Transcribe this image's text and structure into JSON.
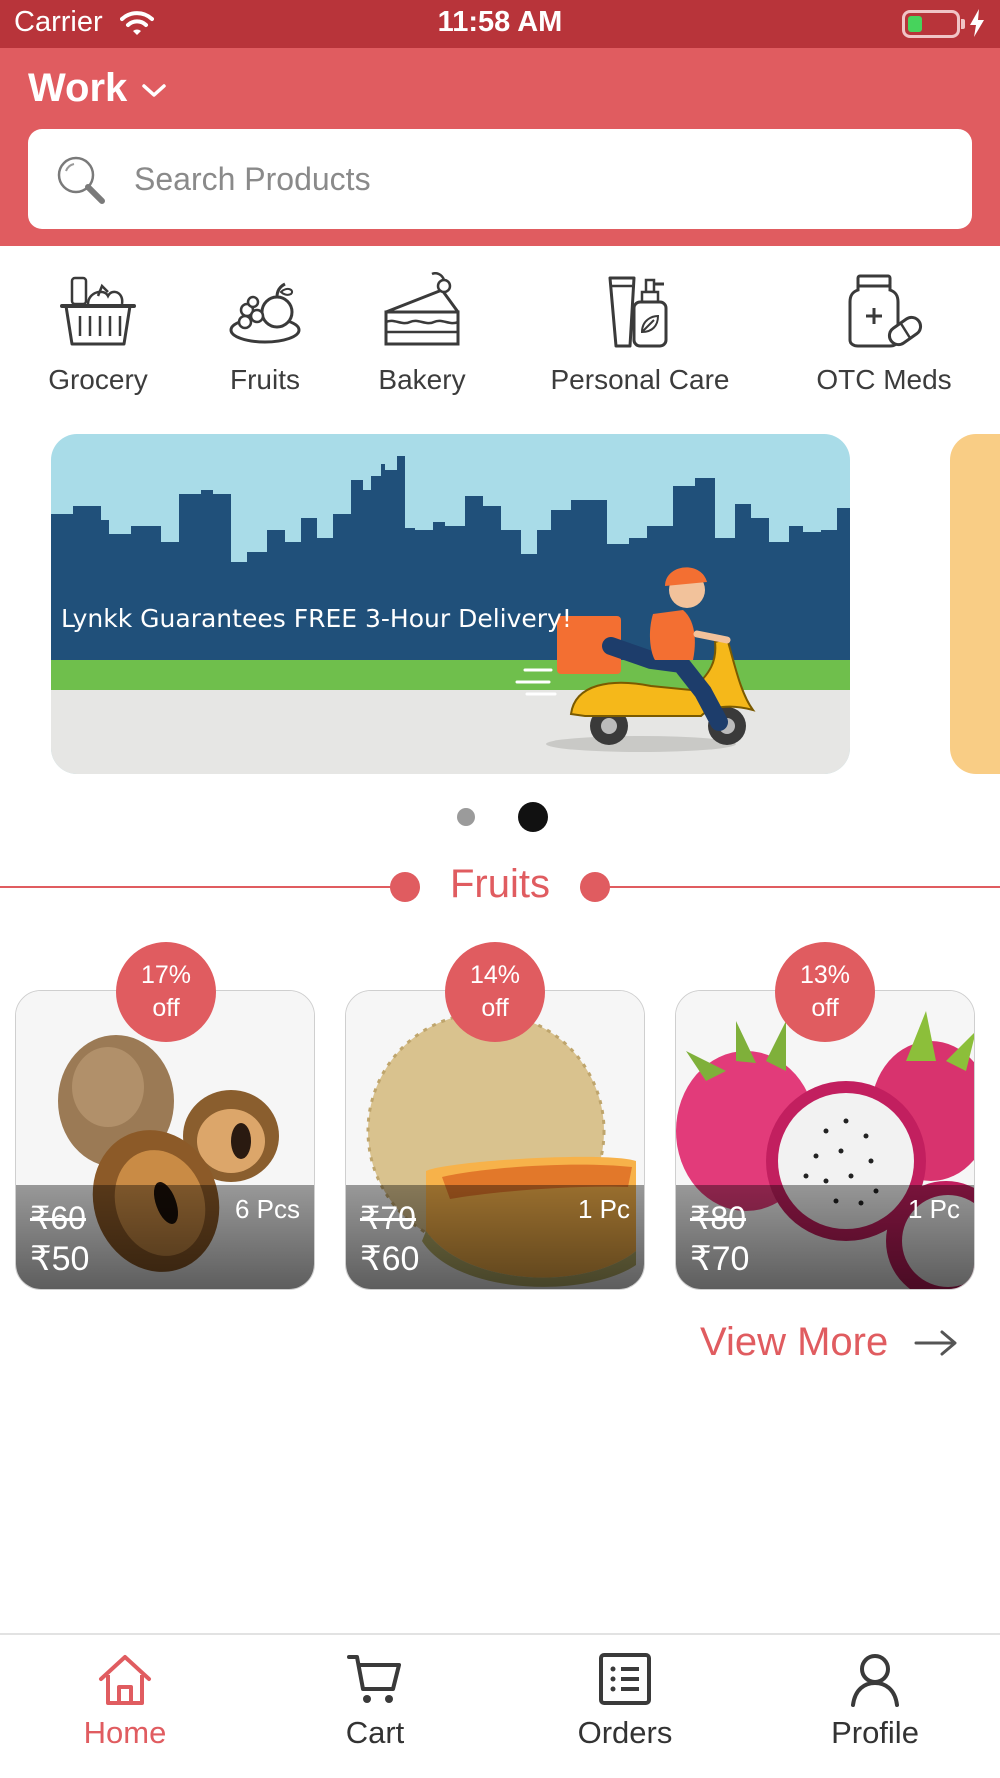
{
  "status_bar": {
    "carrier": "Carrier",
    "time": "11:58 AM",
    "battery_level": 0.3
  },
  "header": {
    "location_label": "Work"
  },
  "search": {
    "placeholder": "Search Products"
  },
  "categories": [
    {
      "label": "Grocery",
      "icon": "grocery-basket-icon"
    },
    {
      "label": "Fruits",
      "icon": "fruits-icon"
    },
    {
      "label": "Bakery",
      "icon": "cake-icon"
    },
    {
      "label": "Personal Care",
      "icon": "lotion-bottle-icon"
    },
    {
      "label": "OTC Meds",
      "icon": "medicine-icon"
    }
  ],
  "banner": {
    "text": "Lynkk Guarantees FREE 3-Hour Delivery!",
    "active_slide": 2,
    "slide_count": 2
  },
  "section": {
    "title": "Fruits"
  },
  "products": [
    {
      "discount_line1": "17%",
      "discount_line2": "off",
      "old_price": "₹60",
      "price": "₹50",
      "quantity": "6 Pcs",
      "image": "sapodilla"
    },
    {
      "discount_line1": "14%",
      "discount_line2": "off",
      "old_price": "₹70",
      "price": "₹60",
      "quantity": "1 Pc",
      "image": "muskmelon"
    },
    {
      "discount_line1": "13%",
      "discount_line2": "off",
      "old_price": "₹80",
      "price": "₹70",
      "quantity": "1 Pc",
      "image": "dragon-fruit"
    }
  ],
  "view_more": {
    "label": "View More"
  },
  "tabs": [
    {
      "label": "Home",
      "icon": "home-icon",
      "active": true
    },
    {
      "label": "Cart",
      "icon": "cart-icon",
      "active": false
    },
    {
      "label": "Orders",
      "icon": "orders-list-icon",
      "active": false
    },
    {
      "label": "Profile",
      "icon": "profile-icon",
      "active": false
    }
  ],
  "colors": {
    "brand": "#e05c60",
    "status_bar": "#b8343a",
    "banner_sky": "#a9dce8",
    "banner_city": "#20507a",
    "banner_grass": "#6fbf4c"
  }
}
